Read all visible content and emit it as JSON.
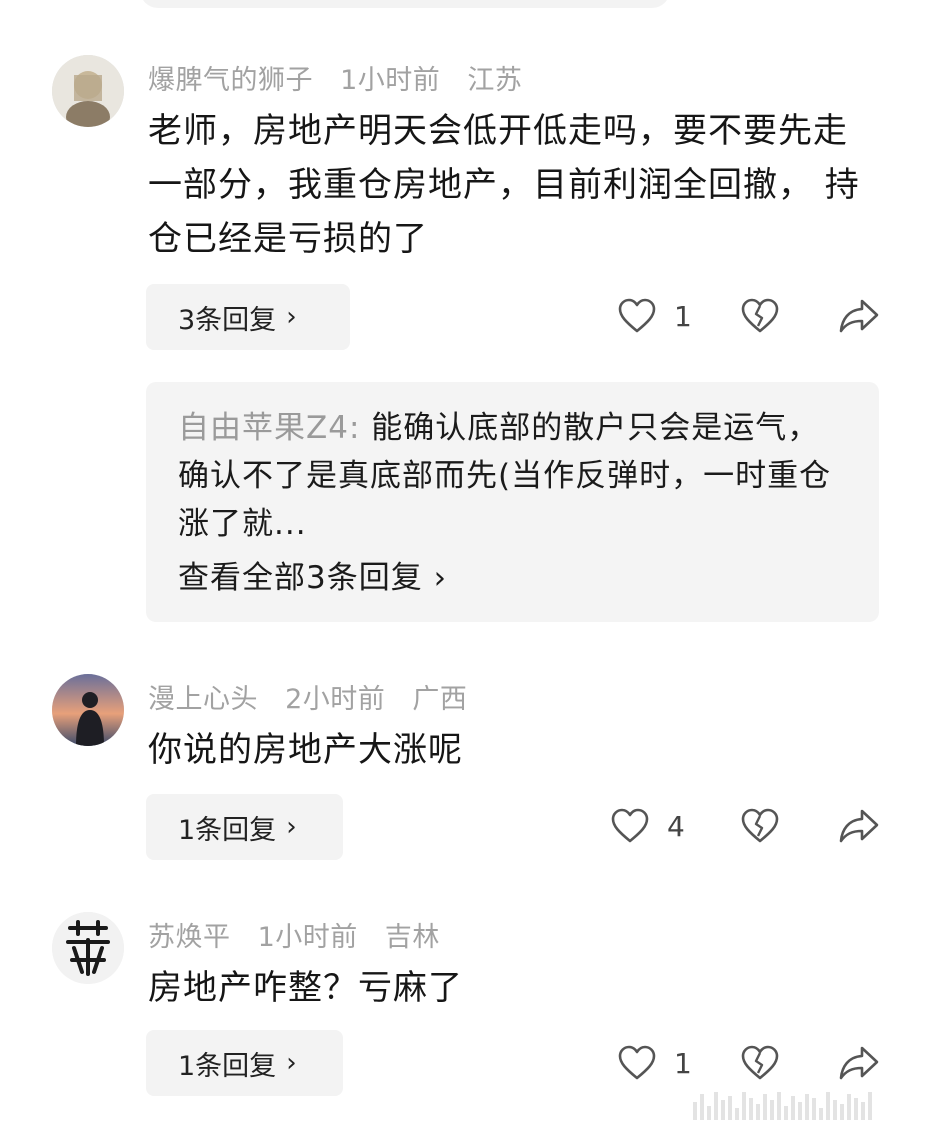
{
  "comments": [
    {
      "author": "爆脾气的狮子",
      "time": "1小时前",
      "location": "江苏",
      "text": "老师，房地产明天会低开低走吗，要不要先走一部分，我重仓房地产，目前利润全回撤， 持仓已经是亏损的了",
      "reply_label": "3条回复",
      "likes": "1",
      "preview": {
        "author": "自由苹果Z4:",
        "text": " 能确认底部的散户只会是运气，确认不了是真底部而先(当作反弹时，一时重仓涨了就...",
        "view_all": "查看全部3条回复"
      }
    },
    {
      "author": "漫上心头",
      "time": "2小时前",
      "location": "广西",
      "text": "你说的房地产大涨呢",
      "reply_label": "1条回复",
      "likes": "4"
    },
    {
      "author": "苏焕平",
      "time": "1小时前",
      "location": "吉林",
      "text": "房地产咋整？亏麻了",
      "reply_label": "1条回复",
      "likes": "1"
    }
  ],
  "icons": {
    "chevron": "chevron-right-icon",
    "like": "heart-icon",
    "dislike": "broken-heart-icon",
    "share": "share-icon"
  },
  "colors": {
    "meta": "#a2a2a2",
    "text": "#161616",
    "pill_bg": "#f3f3f3"
  }
}
